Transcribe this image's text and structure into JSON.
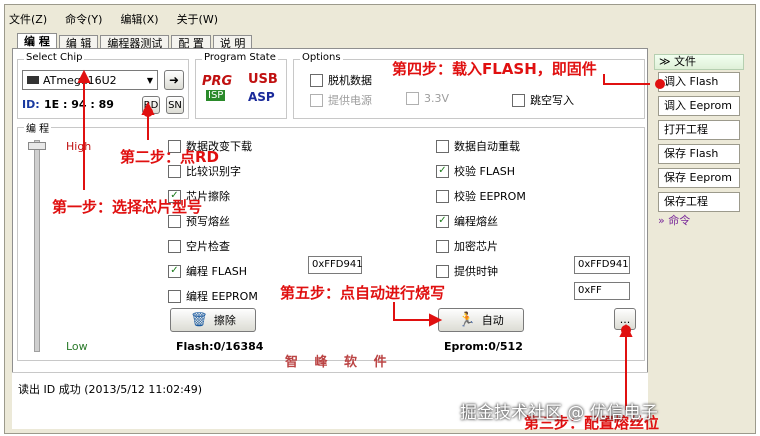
{
  "menu": [
    "文件(Z)",
    "命令(Y)",
    "编辑(X)",
    "关于(W)"
  ],
  "tabs": [
    "编 程",
    "编 辑",
    "编程器测试",
    "配 置",
    "说 明"
  ],
  "select_chip": {
    "legend": "Select Chip",
    "value": "ATmega16U2",
    "id_label": "ID:",
    "id_value": "1E : 94 : 89",
    "rd": "RD",
    "sn": "SN"
  },
  "program_state": {
    "legend": "Program State",
    "prg": "PRG",
    "isp": "ISP",
    "usb": "USB",
    "asp": "ASP"
  },
  "options": {
    "legend": "Options",
    "offline": "脱机数据",
    "power": "提供电源",
    "v33": "3.3V",
    "jump": "跳空写入"
  },
  "prog": {
    "legend": "编 程",
    "high": "High",
    "low": "Low",
    "left": [
      {
        "label": "数据改变下载",
        "checked": false
      },
      {
        "label": "比较识别字",
        "checked": false
      },
      {
        "label": "芯片擦除",
        "checked": true
      },
      {
        "label": "预写熔丝",
        "checked": false
      },
      {
        "label": "空片检查",
        "checked": false
      },
      {
        "label": "编程 FLASH",
        "checked": true
      },
      {
        "label": "编程 EEPROM",
        "checked": false
      }
    ],
    "right": [
      {
        "label": "数据自动重载",
        "checked": false
      },
      {
        "label": "校验 FLASH",
        "checked": true
      },
      {
        "label": "校验 EEPROM",
        "checked": false
      },
      {
        "label": "编程熔丝",
        "checked": true
      },
      {
        "label": "加密芯片",
        "checked": false
      },
      {
        "label": "提供时钟",
        "checked": false
      }
    ],
    "fuse_left": "0xFFD941",
    "fuse_right": "0xFFD941",
    "lock": "0xFF",
    "erase": "擦除",
    "auto": "自动",
    "more": "...",
    "flash": "Flash:0/16384",
    "eprom": "Eprom:0/512",
    "watermark": "智 峰 软 件"
  },
  "sidebar": {
    "file_header": "文件",
    "buttons": [
      "调入 Flash",
      "调入 Eeprom",
      "打开工程",
      "保存 Flash",
      "保存 Eeprom",
      "保存工程"
    ],
    "cmd_header": "命令"
  },
  "log": "读出 ID 成功 (2013/5/12 11:02:49)",
  "annotations": {
    "step1": "第一步：选择芯片型号",
    "step2": "第二步：点RD",
    "step3": "第三步：配置熔丝位",
    "step4": "第四步：载入FLASH，即固件",
    "step5": "第五步：点自动进行烧写"
  },
  "watermark_site": "掘金技术社区 @ 优信电子",
  "colors": {
    "annotation": "#e01010",
    "check": "#1a7a1a"
  }
}
